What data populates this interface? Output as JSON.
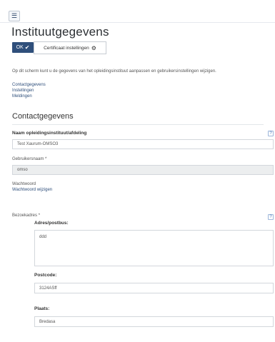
{
  "header": {
    "menu_icon": "hamburger-icon",
    "title": "Instituutgegevens"
  },
  "toolbar": {
    "ok_label": "OK",
    "ok_icon": "checkmark-icon",
    "cert_label": "Certificaat instellingen",
    "cert_icon": "gear-icon"
  },
  "intro": "Op dit scherm kunt u de gegevens van het opleidingsinstituut aanpassen en gebruikersinstellingen wijzigen.",
  "anchors": [
    "Contactgegevens",
    "Instellingen",
    "Meldingen"
  ],
  "section_title": "Contactgegevens",
  "fields": {
    "naam_label": "Naam opleidingsinstituut/afdeling",
    "naam_value": "Test Xaurum-OMSO3",
    "gebruikersnaam_label": "Gebruikersnaam *",
    "gebruikersnaam_value": "omso",
    "wachtwoord_label": "Wachtwoord",
    "wachtwoord_link": "Wachtwoord wijzigen",
    "bezoekadres_label": "Bezoekadres *",
    "adres_label": "Adres/postbus:",
    "adres_value": "ddd",
    "postcode_label": "Postcode:",
    "postcode_value": "3124ASff",
    "plaats_label": "Plaats:",
    "plaats_value": "Bredasa"
  },
  "help_glyph": "?",
  "colors": {
    "primary": "#2f4f7b",
    "link": "#2f4f7b",
    "readonly_bg": "#eceeef"
  }
}
